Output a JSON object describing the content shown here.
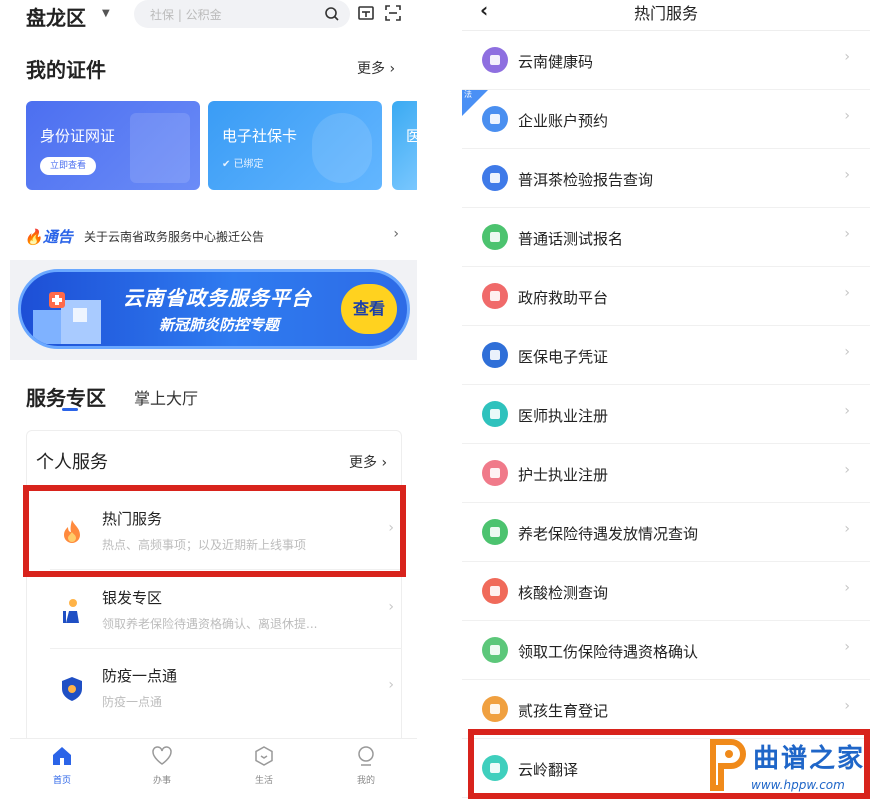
{
  "left": {
    "header": {
      "city": "盘龙区",
      "search_placeholder": "社保 | 公积金"
    },
    "certificates": {
      "title": "我的证件",
      "more": "更多",
      "cards": [
        {
          "title": "身份证网证",
          "action": "立即查看"
        },
        {
          "title": "电子社保卡",
          "status": "已绑定"
        },
        {
          "title": "医"
        }
      ]
    },
    "notice": {
      "tag": "通告",
      "text": "关于云南省政务服务中心搬迁公告"
    },
    "banner": {
      "title": "云南省政务服务平台",
      "subtitle": "新冠肺炎防控专题",
      "button": "查看"
    },
    "service_zone": {
      "title": "服务专区",
      "tab2": "掌上大厅"
    },
    "personal": {
      "title": "个人服务",
      "more": "更多",
      "items": [
        {
          "title": "热门服务",
          "desc": "热点、高频事项；以及近期新上线事项"
        },
        {
          "title": "银发专区",
          "desc": "领取养老保险待遇资格确认、离退休提..."
        },
        {
          "title": "防疫一点通",
          "desc": "防疫一点通"
        }
      ]
    },
    "tabbar": [
      {
        "label": "首页"
      },
      {
        "label": "办事"
      },
      {
        "label": "生活"
      },
      {
        "label": "我的"
      }
    ]
  },
  "right": {
    "title": "热门服务",
    "ribbon": "法",
    "items": [
      {
        "label": "云南健康码",
        "color": "#8e6fe0"
      },
      {
        "label": "企业账户预约",
        "color": "#4a8ff0"
      },
      {
        "label": "普洱茶检验报告查询",
        "color": "#3f7ae8"
      },
      {
        "label": "普通话测试报名",
        "color": "#4cc36f"
      },
      {
        "label": "政府救助平台",
        "color": "#f06a6a"
      },
      {
        "label": "医保电子凭证",
        "color": "#2f6fd8"
      },
      {
        "label": "医师执业注册",
        "color": "#2fc2bd"
      },
      {
        "label": "护士执业注册",
        "color": "#f07a8a"
      },
      {
        "label": "养老保险待遇发放情况查询",
        "color": "#4cc36f"
      },
      {
        "label": "核酸检测查询",
        "color": "#f06a5a"
      },
      {
        "label": "领取工伤保险待遇资格确认",
        "color": "#5cc77a"
      },
      {
        "label": "贰孩生育登记",
        "color": "#f0a040"
      },
      {
        "label": "云岭翻译",
        "color": "#3fcfbd"
      }
    ]
  },
  "watermark": {
    "title": "曲谱之家",
    "url": "www.hppw.com"
  },
  "colors": {
    "accent": "#2b64e8",
    "highlight": "#d8231c"
  }
}
